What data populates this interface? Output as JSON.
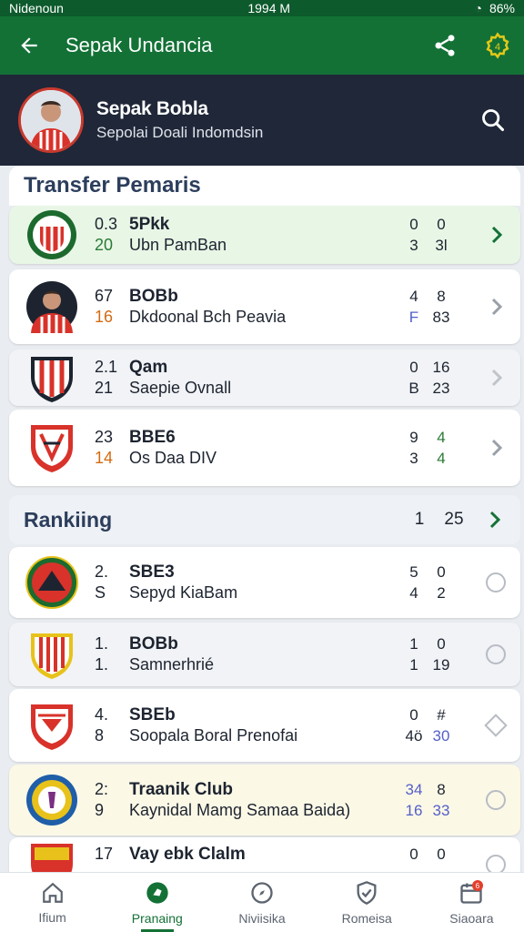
{
  "status": {
    "carrier": "Nidenoun",
    "time": "1994 M",
    "battery": "86%"
  },
  "appbar": {
    "title": "Sepak Undancia",
    "back_icon": "arrow-left-icon",
    "share_icon": "share-icon",
    "settings_icon": "settings-icon"
  },
  "profile": {
    "name": "Sepak Bobla",
    "subtitle": "Sepolai Doali Indomdsin",
    "search_icon": "search-icon"
  },
  "transfers": {
    "title": "Transfer Pemaris",
    "items": [
      {
        "n1": "0.3",
        "n2": "20",
        "t1": "5Pkk",
        "t2": "Ubn PamBan",
        "s1": "0",
        "s2": "3",
        "s3": "0",
        "s4": "3l",
        "style": "green"
      },
      {
        "n1": "67",
        "n2": "16",
        "t1": "BOBb",
        "t2": "Dkdoonal Bch Peavia",
        "s1": "4",
        "s2": "F",
        "s3": "8",
        "s4": "83",
        "style": "white"
      },
      {
        "n1": "2.1",
        "n2": "21",
        "t1": "Qam",
        "t2": "Saepie Ovnall",
        "s1": "0",
        "s2": "B",
        "s3": "16",
        "s4": "23",
        "style": "grey"
      },
      {
        "n1": "23",
        "n2": "14",
        "t1": "BBE6",
        "t2": "Os Daa DIV",
        "s1": "9",
        "s2": "3",
        "s3": "4",
        "s4": "4",
        "style": "white"
      }
    ]
  },
  "ranking": {
    "title": "Rankiing",
    "n1": "1",
    "n2": "25",
    "items": [
      {
        "n1": "2.",
        "n2": "S",
        "t1": "SBE3",
        "t2": "Sepyd KiaBam",
        "s1": "5",
        "s2": "4",
        "s3": "0",
        "s4": "2",
        "style": "white",
        "end": "ring"
      },
      {
        "n1": "1.",
        "n2": "1.",
        "t1": "BOBb",
        "t2": "Samnerhrié",
        "s1": "1",
        "s2": "1",
        "s3": "0",
        "s4": "19",
        "style": "grey",
        "end": "ring"
      },
      {
        "n1": "4.",
        "n2": "8",
        "t1": "SBEb",
        "t2": "Soopala Boral Prenofai",
        "s1": "0",
        "s2": "4ö",
        "s3": "#",
        "s4": "30",
        "style": "white",
        "end": "diamond"
      },
      {
        "n1": "2:",
        "n2": "9",
        "t1": "Traanik Club",
        "t2": "Kaynidal Mamg Samaa Baida)",
        "s1": "34",
        "s2": "16",
        "s3": "8",
        "s4": "33",
        "style": "cream",
        "end": "ring"
      },
      {
        "n1": "17",
        "n2": "",
        "t1": "Vay ebk Clalm",
        "t2": "",
        "s1": "0",
        "s2": "",
        "s3": "0",
        "s4": "",
        "style": "white",
        "end": "ring"
      }
    ]
  },
  "nav": [
    {
      "label": "Ifium",
      "icon": "home-icon"
    },
    {
      "label": "Pranaing",
      "icon": "ball-icon"
    },
    {
      "label": "Niviisika",
      "icon": "compass-icon"
    },
    {
      "label": "Romeisa",
      "icon": "shield-icon"
    },
    {
      "label": "Siaoara",
      "icon": "calendar-icon"
    }
  ],
  "colors": {
    "primary": "#137136",
    "header": "#1f2738",
    "accent_orange": "#d36b12",
    "accent_blue": "#5560c8"
  }
}
